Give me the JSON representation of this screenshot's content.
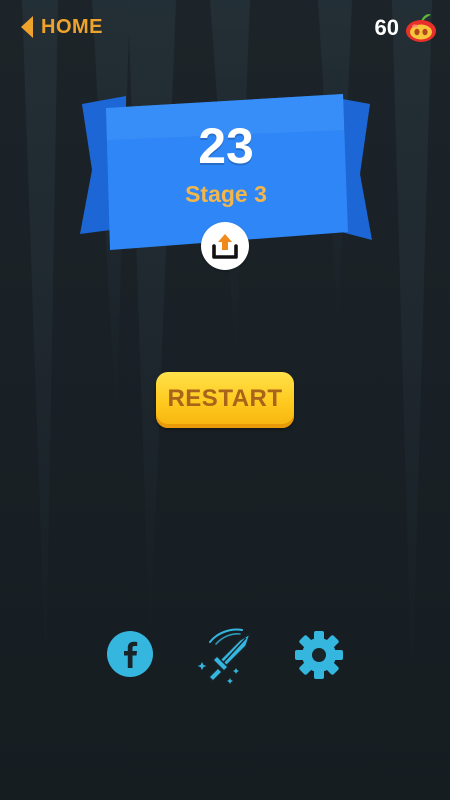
{
  "top_bar": {
    "home_label": "HOME",
    "apple_count": "60"
  },
  "result": {
    "score": "23",
    "stage_label": "Stage 3"
  },
  "restart_label": "RESTART",
  "icons": {
    "back": "chevron-left-icon",
    "apple": "apple-icon",
    "share": "share-icon",
    "facebook": "facebook-icon",
    "weapons": "sword-icon",
    "settings": "gear-icon"
  },
  "colors": {
    "background": "#1a2126",
    "accent_orange": "#f0a32a",
    "ribbon_blue": "#2f86f6",
    "restart_yellow": "#ffcc22",
    "icon_cyan": "#35b6df"
  }
}
